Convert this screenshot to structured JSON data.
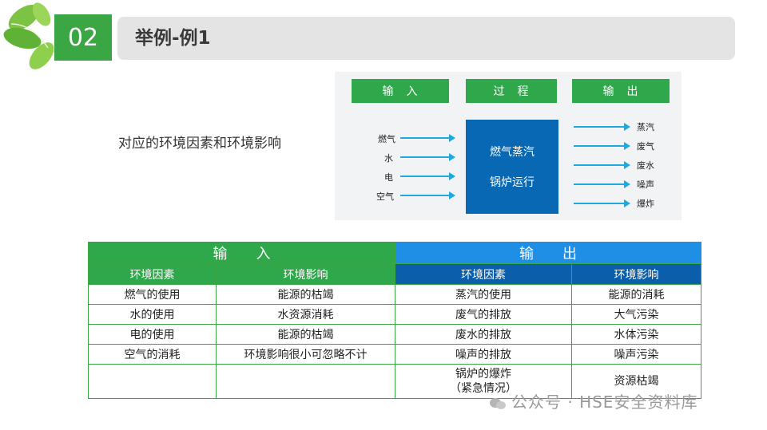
{
  "header": {
    "number": "02",
    "title": "举例-例1"
  },
  "subtitle": "对应的环境因素和环境影响",
  "diagram": {
    "input_label": "输　入",
    "process_label": "过　程",
    "output_label": "输　出",
    "inputs": [
      "燃气",
      "水",
      "电",
      "空气"
    ],
    "process_lines": [
      "燃气蒸汽",
      "锅炉运行"
    ],
    "outputs": [
      "蒸汽",
      "废气",
      "废水",
      "噪声",
      "爆炸"
    ]
  },
  "table": {
    "input_header": "输　　入",
    "output_header": "输　　出",
    "sub_headers": [
      "环境因素",
      "环境影响",
      "环境因素",
      "环境影响"
    ],
    "rows": [
      [
        "燃气的使用",
        "能源的枯竭",
        "蒸汽的使用",
        "能源的消耗"
      ],
      [
        "水的使用",
        "水资源消耗",
        "废气的排放",
        "大气污染"
      ],
      [
        "电的使用",
        "能源的枯竭",
        "废水的排放",
        "水体污染"
      ],
      [
        "空气的消耗",
        "环境影响很小可忽略不计",
        "噪声的排放",
        "噪声污染"
      ]
    ],
    "last_row": [
      "",
      "",
      "锅炉的爆炸",
      "（紧急情况）",
      "资源枯竭"
    ]
  },
  "watermark": "公众号 · HSE安全资料库",
  "colors": {
    "green": "#2ea84a",
    "blue_light": "#1f8fe6",
    "blue_dark": "#0b5eaa",
    "process_box": "#0868b4"
  }
}
